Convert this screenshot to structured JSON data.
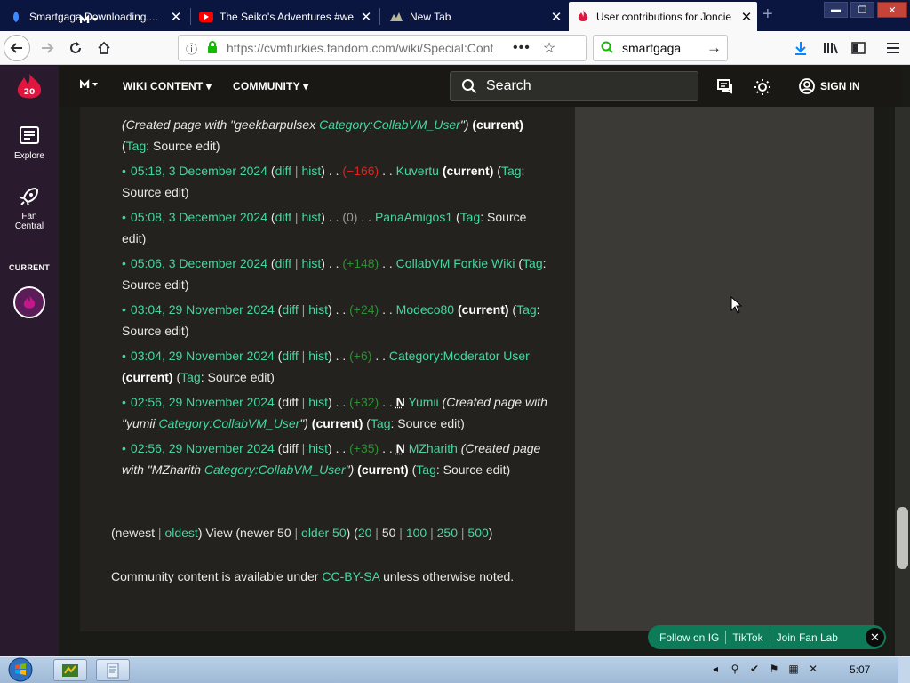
{
  "browser": {
    "tabs": [
      {
        "label": "Smartgaga Downloading....",
        "icon": "smartgaga-icon"
      },
      {
        "label": "The Seiko's Adventures #we",
        "icon": "youtube-icon"
      },
      {
        "label": "New Tab",
        "icon": "firefox-newtab-icon"
      },
      {
        "label": "User contributions for Joncie",
        "icon": "fandom-flame-icon",
        "active": true
      }
    ],
    "url": "https://cvmfurkies.fandom.com/wiki/Special:Contrib",
    "search_value": "smartgaga",
    "window_controls": [
      "minimize",
      "restore",
      "close"
    ]
  },
  "rail": {
    "logo_badge": "20",
    "items": [
      {
        "label": "Explore",
        "icon": "explore-icon"
      },
      {
        "label_line1": "Fan",
        "label_line2": "Central",
        "icon": "rocket-icon"
      }
    ],
    "current_label": "CURRENT"
  },
  "header": {
    "nav": [
      {
        "label": "WIKI CONTENT ▾"
      },
      {
        "label": "COMMUNITY ▾"
      }
    ],
    "search_placeholder": "Search",
    "signin_label": "SIGN IN"
  },
  "contributions": [
    {
      "parts": [
        {
          "t": "(Created page with \"geekbarpulsex ",
          "c": "ital"
        },
        {
          "t": "Category:CollabVM_User",
          "c": "lnk ital"
        },
        {
          "t": "\")",
          "c": "ital"
        },
        {
          "t": " ",
          "c": ""
        },
        {
          "t": "(current)",
          "c": "bold"
        },
        {
          "t": " (",
          "c": ""
        },
        {
          "t": "Tag",
          "c": "lnk"
        },
        {
          "t": ": Source edit)",
          "c": ""
        }
      ],
      "nobullet": true
    },
    {
      "parts": [
        {
          "t": "05:18, 3 December 2024",
          "c": "lnk"
        },
        {
          "t": " (",
          "c": ""
        },
        {
          "t": "diff",
          "c": "lnk"
        },
        {
          "t": " | ",
          "c": "pipe"
        },
        {
          "t": "hist",
          "c": "lnk"
        },
        {
          "t": ") . . ",
          "c": ""
        },
        {
          "t": "(−166)",
          "c": "neg"
        },
        {
          "t": " . . ",
          "c": ""
        },
        {
          "t": "Kuvertu",
          "c": "lnk"
        },
        {
          "t": " ",
          "c": ""
        },
        {
          "t": "(current)",
          "c": "bold"
        },
        {
          "t": " (",
          "c": ""
        },
        {
          "t": "Tag",
          "c": "lnk"
        },
        {
          "t": ": Source edit)",
          "c": ""
        }
      ]
    },
    {
      "parts": [
        {
          "t": "05:08, 3 December 2024",
          "c": "lnk"
        },
        {
          "t": " (",
          "c": ""
        },
        {
          "t": "diff",
          "c": "lnk"
        },
        {
          "t": " | ",
          "c": "pipe"
        },
        {
          "t": "hist",
          "c": "lnk"
        },
        {
          "t": ") . . ",
          "c": ""
        },
        {
          "t": "(0)",
          "c": "gray"
        },
        {
          "t": " . . ",
          "c": ""
        },
        {
          "t": "PanaAmigos1",
          "c": "lnk"
        },
        {
          "t": " (",
          "c": ""
        },
        {
          "t": "Tag",
          "c": "lnk"
        },
        {
          "t": ": Source edit)",
          "c": ""
        }
      ]
    },
    {
      "parts": [
        {
          "t": "05:06, 3 December 2024",
          "c": "lnk"
        },
        {
          "t": " (",
          "c": ""
        },
        {
          "t": "diff",
          "c": "lnk"
        },
        {
          "t": " | ",
          "c": "pipe"
        },
        {
          "t": "hist",
          "c": "lnk"
        },
        {
          "t": ") . . ",
          "c": ""
        },
        {
          "t": "(+148)",
          "c": "pos"
        },
        {
          "t": " . . ",
          "c": ""
        },
        {
          "t": "CollabVM Forkie Wiki",
          "c": "lnk"
        },
        {
          "t": " (",
          "c": ""
        },
        {
          "t": "Tag",
          "c": "lnk"
        },
        {
          "t": ": Source edit)",
          "c": ""
        }
      ]
    },
    {
      "parts": [
        {
          "t": "03:04, 29 November 2024",
          "c": "lnk"
        },
        {
          "t": " (",
          "c": ""
        },
        {
          "t": "diff",
          "c": "lnk"
        },
        {
          "t": " | ",
          "c": "pipe"
        },
        {
          "t": "hist",
          "c": "lnk"
        },
        {
          "t": ") . . ",
          "c": ""
        },
        {
          "t": "(+24)",
          "c": "pos"
        },
        {
          "t": " . . ",
          "c": ""
        },
        {
          "t": "Modeco80",
          "c": "lnk"
        },
        {
          "t": " ",
          "c": ""
        },
        {
          "t": "(current)",
          "c": "bold"
        },
        {
          "t": " (",
          "c": ""
        },
        {
          "t": "Tag",
          "c": "lnk"
        },
        {
          "t": ": Source edit)",
          "c": ""
        }
      ]
    },
    {
      "parts": [
        {
          "t": "03:04, 29 November 2024",
          "c": "lnk"
        },
        {
          "t": " (",
          "c": ""
        },
        {
          "t": "diff",
          "c": "lnk"
        },
        {
          "t": " | ",
          "c": "pipe"
        },
        {
          "t": "hist",
          "c": "lnk"
        },
        {
          "t": ") . . ",
          "c": ""
        },
        {
          "t": "(+6)",
          "c": "pos"
        },
        {
          "t": " . . ",
          "c": ""
        },
        {
          "t": "Category:Moderator User",
          "c": "lnk"
        },
        {
          "t": " ",
          "c": ""
        },
        {
          "t": "(current)",
          "c": "bold"
        },
        {
          "t": " (",
          "c": ""
        },
        {
          "t": "Tag",
          "c": "lnk"
        },
        {
          "t": ": Source edit)",
          "c": ""
        }
      ]
    },
    {
      "parts": [
        {
          "t": "02:56, 29 November 2024",
          "c": "lnk"
        },
        {
          "t": " (",
          "c": ""
        },
        {
          "t": "diff",
          "c": ""
        },
        {
          "t": " | ",
          "c": "pipe"
        },
        {
          "t": "hist",
          "c": "lnk"
        },
        {
          "t": ") . . ",
          "c": ""
        },
        {
          "t": "(+32)",
          "c": "pos"
        },
        {
          "t": " . . ",
          "c": ""
        },
        {
          "t": "N",
          "c": "nflag"
        },
        {
          "t": " ",
          "c": ""
        },
        {
          "t": "Yumii",
          "c": "lnk"
        },
        {
          "t": " (Created page with \"yumii ",
          "c": "ital"
        },
        {
          "t": "Category:CollabVM_User",
          "c": "lnk ital"
        },
        {
          "t": "\")",
          "c": "ital"
        },
        {
          "t": " ",
          "c": ""
        },
        {
          "t": "(current)",
          "c": "bold"
        },
        {
          "t": " (",
          "c": ""
        },
        {
          "t": "Tag",
          "c": "lnk"
        },
        {
          "t": ": Source edit)",
          "c": ""
        }
      ]
    },
    {
      "parts": [
        {
          "t": "02:56, 29 November 2024",
          "c": "lnk"
        },
        {
          "t": " (",
          "c": ""
        },
        {
          "t": "diff",
          "c": ""
        },
        {
          "t": " | ",
          "c": "pipe"
        },
        {
          "t": "hist",
          "c": "lnk"
        },
        {
          "t": ") . . ",
          "c": ""
        },
        {
          "t": "(+35)",
          "c": "pos"
        },
        {
          "t": " . . ",
          "c": ""
        },
        {
          "t": "N",
          "c": "nflag"
        },
        {
          "t": " ",
          "c": ""
        },
        {
          "t": "MZharith",
          "c": "lnk"
        },
        {
          "t": " (Created page with \"MZharith ",
          "c": "ital"
        },
        {
          "t": "Category:CollabVM_User",
          "c": "lnk ital"
        },
        {
          "t": "\")",
          "c": "ital"
        },
        {
          "t": " ",
          "c": ""
        },
        {
          "t": "(current)",
          "c": "bold"
        },
        {
          "t": " (",
          "c": ""
        },
        {
          "t": "Tag",
          "c": "lnk"
        },
        {
          "t": ": Source edit)",
          "c": ""
        }
      ]
    }
  ],
  "pager": [
    {
      "t": "(newest",
      "c": ""
    },
    {
      "t": " | ",
      "c": "pipe"
    },
    {
      "t": "oldest",
      "c": "lnk"
    },
    {
      "t": ") View (newer 50",
      "c": ""
    },
    {
      "t": " | ",
      "c": "pipe"
    },
    {
      "t": "older 50",
      "c": "lnk"
    },
    {
      "t": ") (",
      "c": ""
    },
    {
      "t": "20",
      "c": "lnk"
    },
    {
      "t": " | ",
      "c": "pipe"
    },
    {
      "t": "50",
      "c": ""
    },
    {
      "t": " | ",
      "c": "pipe"
    },
    {
      "t": "100",
      "c": "lnk"
    },
    {
      "t": " | ",
      "c": "pipe"
    },
    {
      "t": "250",
      "c": "lnk"
    },
    {
      "t": " | ",
      "c": "pipe"
    },
    {
      "t": "500",
      "c": "lnk"
    },
    {
      "t": ")",
      "c": ""
    }
  ],
  "license": {
    "before": "Community content is available under ",
    "link": "CC-BY-SA",
    "after": " unless otherwise noted."
  },
  "follow_bar": {
    "items": [
      "Follow on IG",
      "TikTok",
      "Join Fan Lab"
    ],
    "close": "✕"
  },
  "taskbar": {
    "clock": "5:07"
  },
  "colors": {
    "link": "#46d6a3",
    "positive_delta": "#2d8f33",
    "negative_delta": "#d9251e",
    "rail_bg": "#2a1a2e",
    "follow_bar": "#0d7a58"
  }
}
